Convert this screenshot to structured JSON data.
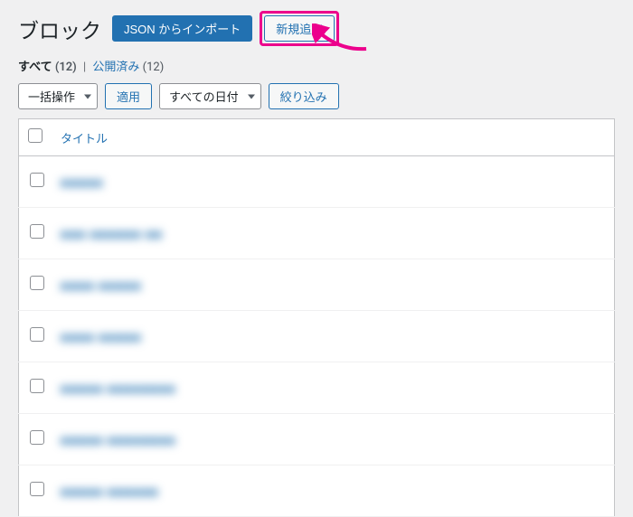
{
  "header": {
    "title": "ブロック",
    "import_btn": "JSON からインポート",
    "add_new_btn": "新規追加"
  },
  "subsub": {
    "all_label": "すべて",
    "all_count": "(12)",
    "published_label": "公開済み",
    "published_count": "(12)"
  },
  "nav": {
    "bulk_action": "一括操作",
    "apply": "適用",
    "all_dates": "すべての日付",
    "filter": "絞り込み"
  },
  "table": {
    "title_header": "タイトル",
    "rows": [
      {
        "title": "■■■■■"
      },
      {
        "title": "■■■  ■■■■■■ ■■"
      },
      {
        "title": "■■■■  ■■■■■"
      },
      {
        "title": "■■■■  ■■■■■"
      },
      {
        "title": "■■■■■  ■■■■■■■■"
      },
      {
        "title": "■■■■■  ■■■■■■■■"
      },
      {
        "title": "■■■■■  ■■■■■■"
      }
    ]
  }
}
